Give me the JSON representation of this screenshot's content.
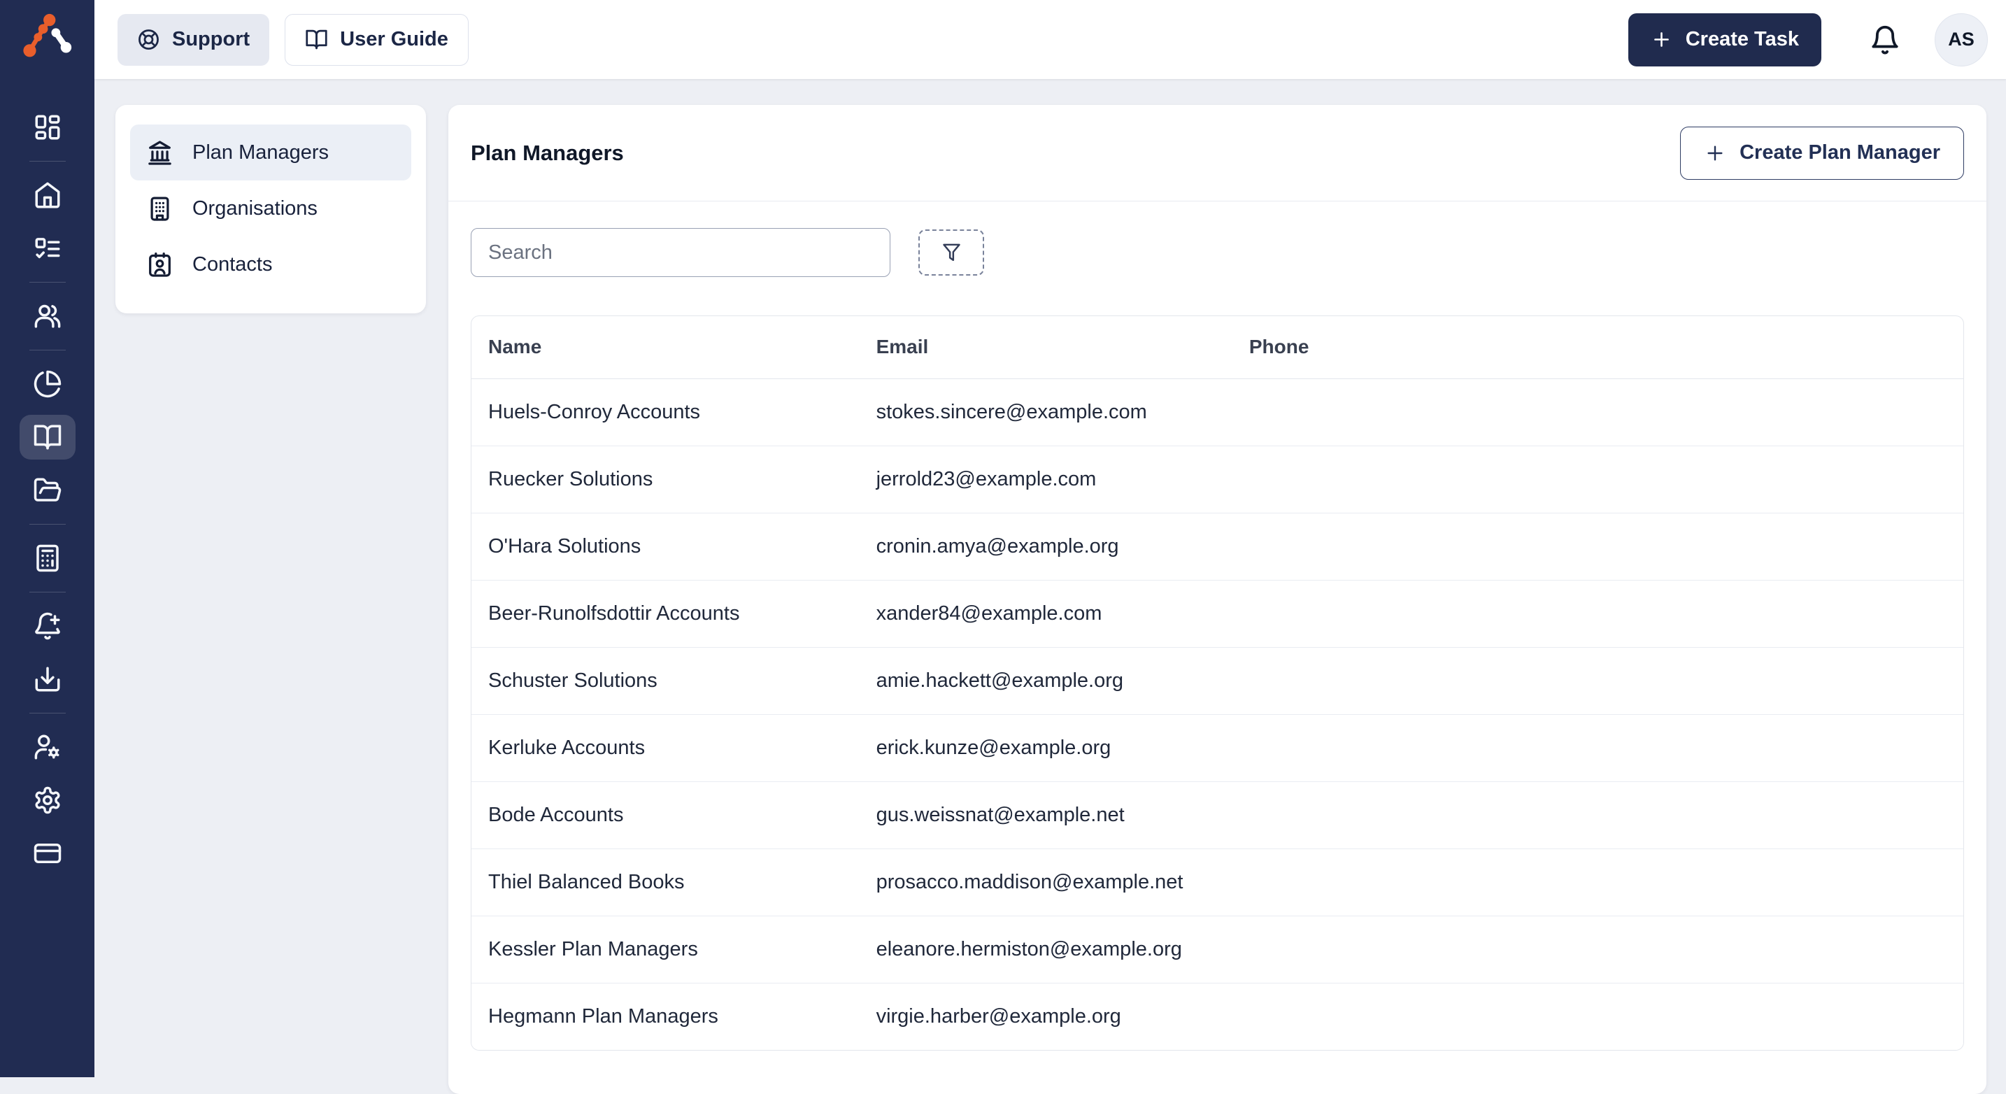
{
  "topbar": {
    "support": "Support",
    "user_guide": "User Guide",
    "create_task": "Create Task",
    "avatar_initials": "AS"
  },
  "primary_nav": {
    "icons": [
      "dashboard",
      "home",
      "tasks",
      "people",
      "reports-pie",
      "plan-managers-book",
      "documents-folder",
      "calculator",
      "notifications-add",
      "downloads",
      "user-settings",
      "settings",
      "billing-card"
    ],
    "active_icon": "plan-managers-book"
  },
  "subnav": {
    "items": [
      {
        "label": "Plan Managers",
        "icon": "landmark-icon",
        "active": true
      },
      {
        "label": "Organisations",
        "icon": "building-icon",
        "active": false
      },
      {
        "label": "Contacts",
        "icon": "contact-card-icon",
        "active": false
      }
    ]
  },
  "page": {
    "title": "Plan Managers",
    "create_button": "Create Plan Manager",
    "search_placeholder": "Search",
    "table": {
      "columns": [
        "Name",
        "Email",
        "Phone"
      ],
      "rows": [
        {
          "name": "Huels-Conroy Accounts",
          "email": "stokes.sincere@example.com",
          "phone": ""
        },
        {
          "name": "Ruecker Solutions",
          "email": "jerrold23@example.com",
          "phone": ""
        },
        {
          "name": "O'Hara Solutions",
          "email": "cronin.amya@example.org",
          "phone": ""
        },
        {
          "name": "Beer-Runolfsdottir Accounts",
          "email": "xander84@example.com",
          "phone": ""
        },
        {
          "name": "Schuster Solutions",
          "email": "amie.hackett@example.org",
          "phone": ""
        },
        {
          "name": "Kerluke Accounts",
          "email": "erick.kunze@example.org",
          "phone": ""
        },
        {
          "name": "Bode Accounts",
          "email": "gus.weissnat@example.net",
          "phone": ""
        },
        {
          "name": "Thiel Balanced Books",
          "email": "prosacco.maddison@example.net",
          "phone": ""
        },
        {
          "name": "Kessler Plan Managers",
          "email": "eleanore.hermiston@example.org",
          "phone": ""
        },
        {
          "name": "Hegmann Plan Managers",
          "email": "virgie.harber@example.org",
          "phone": ""
        }
      ]
    }
  },
  "colors": {
    "navy": "#212c52",
    "accent_orange": "#e95e2b",
    "page_bg": "#edeff4",
    "active_item_bg": "#ebeff6",
    "table_border": "#e3e6ec"
  }
}
